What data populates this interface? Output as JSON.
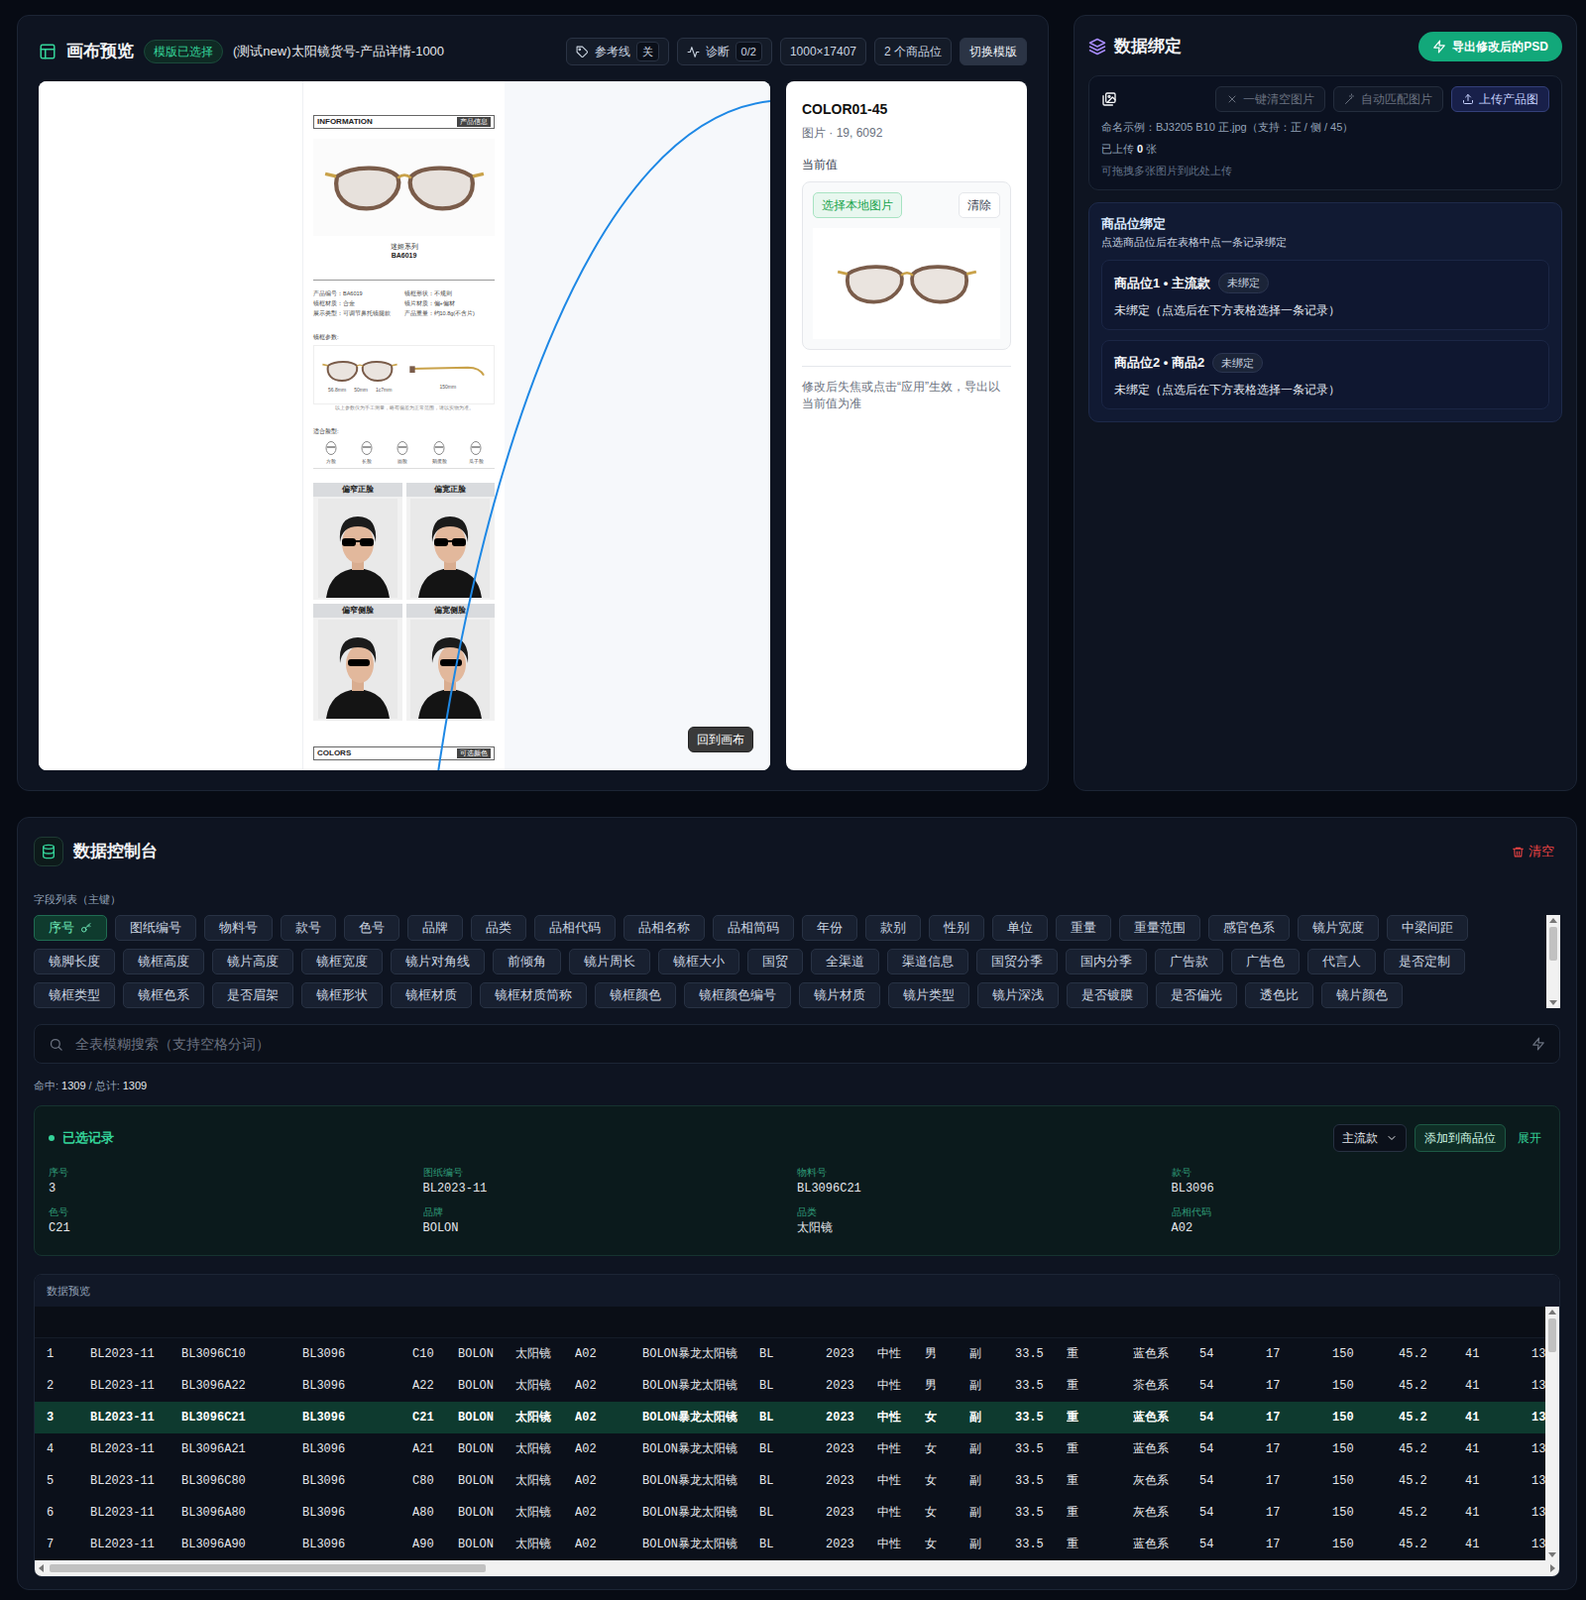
{
  "canvas_panel": {
    "title": "画布预览",
    "template_badge": "模版已选择",
    "template_name": "(测试new)太阳镜货号-产品详情-1000",
    "toolbar": [
      {
        "label": "参考线",
        "value": "关",
        "kind": "toggle"
      },
      {
        "label": "诊断",
        "value": "0/2",
        "kind": "diagnose"
      },
      {
        "label": "1000×17407",
        "kind": "info"
      },
      {
        "label": "2 个商品位",
        "kind": "info"
      },
      {
        "label": "切换模版",
        "kind": "action"
      }
    ],
    "back_button": "回到画布"
  },
  "document": {
    "header": [
      "INFORMATION",
      "产品信息"
    ],
    "series": "迷姬系列",
    "model": "BA6019",
    "specs": [
      [
        "产品编号：BA6019",
        "镜框形状：不规则"
      ],
      [
        "镜框材质：合金",
        "镜片材质：偏+偏材"
      ],
      [
        "展示类型：可调节鼻托镜腿款",
        "产品重量：约10.8g(不含片)"
      ]
    ],
    "params_label": "镜框参数:",
    "dims": [
      "56.8mm",
      "50mm",
      "1c7mm",
      "150mm"
    ],
    "note": "以上参数仅为手工测量，略有偏差为正常范围，请以实物为准。",
    "faces_label": "适合脸型:",
    "faces": [
      "方脸",
      "长脸",
      "圆脸",
      "鹅蛋脸",
      "瓜子脸"
    ],
    "photos": [
      "偏窄正脸",
      "偏宽正脸",
      "偏窄侧脸",
      "偏宽侧脸"
    ],
    "footer": [
      "COLORS",
      "可选颜色"
    ]
  },
  "layer_card": {
    "name": "COLOR01-45",
    "meta": "图片 · 19, 6092",
    "current_label": "当前值",
    "choose": "选择本地图片",
    "clear": "清除",
    "hint": "修改后失焦或点击“应用”生效，导出以当前值为准"
  },
  "binding_panel": {
    "title": "数据绑定",
    "export": "导出修改后的PSD",
    "upload": {
      "actions": [
        {
          "label": "一键清空图片",
          "kind": "ghost"
        },
        {
          "label": "自动匹配图片",
          "kind": "ghost"
        },
        {
          "label": "上传产品图",
          "kind": "primary"
        }
      ],
      "naming": "命名示例：BJ3205 B10 正.jpg（支持：正 / 侧 / 45）",
      "uploaded": {
        "prefix": "已上传",
        "count": "0",
        "suffix": "张"
      },
      "drop_hint": "可拖拽多张图片到此处上传"
    },
    "slots": {
      "title": "商品位绑定",
      "hint": "点选商品位后在表格中点一条记录绑定",
      "items": [
        {
          "name": "商品位1 • 主流款",
          "status": "未绑定",
          "detail": "未绑定（点选后在下方表格选择一条记录）"
        },
        {
          "name": "商品位2 • 商品2",
          "status": "未绑定",
          "detail": "未绑定（点选后在下方表格选择一条记录）"
        }
      ]
    }
  },
  "console": {
    "title": "数据控制台",
    "clear": "清空",
    "fields_label": "字段列表（主键）",
    "fields": [
      {
        "label": "序号",
        "selected": true,
        "primary_key": true
      },
      {
        "label": "图纸编号",
        "selected": false,
        "primary_key": false
      },
      {
        "label": "物料号",
        "selected": false,
        "primary_key": false
      },
      {
        "label": "款号",
        "selected": false,
        "primary_key": false
      },
      {
        "label": "色号",
        "selected": false,
        "primary_key": false
      },
      {
        "label": "品牌",
        "selected": false,
        "primary_key": false
      },
      {
        "label": "品类",
        "selected": false,
        "primary_key": false
      },
      {
        "label": "品相代码",
        "selected": false,
        "primary_key": false
      },
      {
        "label": "品相名称",
        "selected": false,
        "primary_key": false
      },
      {
        "label": "品相简码",
        "selected": false,
        "primary_key": false
      },
      {
        "label": "年份",
        "selected": false,
        "primary_key": false
      },
      {
        "label": "款别",
        "selected": false,
        "primary_key": false
      },
      {
        "label": "性别",
        "selected": false,
        "primary_key": false
      },
      {
        "label": "单位",
        "selected": false,
        "primary_key": false
      },
      {
        "label": "重量",
        "selected": false,
        "primary_key": false
      },
      {
        "label": "重量范围",
        "selected": false,
        "primary_key": false
      },
      {
        "label": "感官色系",
        "selected": false,
        "primary_key": false
      },
      {
        "label": "镜片宽度",
        "selected": false,
        "primary_key": false
      },
      {
        "label": "中梁间距",
        "selected": false,
        "primary_key": false
      },
      {
        "label": "镜脚长度",
        "selected": false,
        "primary_key": false
      },
      {
        "label": "镜框高度",
        "selected": false,
        "primary_key": false
      },
      {
        "label": "镜片高度",
        "selected": false,
        "primary_key": false
      },
      {
        "label": "镜框宽度",
        "selected": false,
        "primary_key": false
      },
      {
        "label": "镜片对角线",
        "selected": false,
        "primary_key": false
      },
      {
        "label": "前倾角",
        "selected": false,
        "primary_key": false
      },
      {
        "label": "镜片周长",
        "selected": false,
        "primary_key": false
      },
      {
        "label": "镜框大小",
        "selected": false,
        "primary_key": false
      },
      {
        "label": "国贸",
        "selected": false,
        "primary_key": false
      },
      {
        "label": "全渠道",
        "selected": false,
        "primary_key": false
      },
      {
        "label": "渠道信息",
        "selected": false,
        "primary_key": false
      },
      {
        "label": "国贸分季",
        "selected": false,
        "primary_key": false
      },
      {
        "label": "国内分季",
        "selected": false,
        "primary_key": false
      },
      {
        "label": "广告款",
        "selected": false,
        "primary_key": false
      },
      {
        "label": "广告色",
        "selected": false,
        "primary_key": false
      },
      {
        "label": "代言人",
        "selected": false,
        "primary_key": false
      },
      {
        "label": "是否定制",
        "selected": false,
        "primary_key": false
      },
      {
        "label": "镜框类型",
        "selected": false,
        "primary_key": false
      },
      {
        "label": "镜框色系",
        "selected": false,
        "primary_key": false
      },
      {
        "label": "是否眉架",
        "selected": false,
        "primary_key": false
      },
      {
        "label": "镜框形状",
        "selected": false,
        "primary_key": false
      },
      {
        "label": "镜框材质",
        "selected": false,
        "primary_key": false
      },
      {
        "label": "镜框材质简称",
        "selected": false,
        "primary_key": false
      },
      {
        "label": "镜框颜色",
        "selected": false,
        "primary_key": false
      },
      {
        "label": "镜框颜色编号",
        "selected": false,
        "primary_key": false
      },
      {
        "label": "镜片材质",
        "selected": false,
        "primary_key": false
      },
      {
        "label": "镜片类型",
        "selected": false,
        "primary_key": false
      },
      {
        "label": "镜片深浅",
        "selected": false,
        "primary_key": false
      },
      {
        "label": "是否镀膜",
        "selected": false,
        "primary_key": false
      },
      {
        "label": "是否偏光",
        "selected": false,
        "primary_key": false
      },
      {
        "label": "透色比",
        "selected": false,
        "primary_key": false
      },
      {
        "label": "镜片颜色",
        "selected": false,
        "primary_key": false
      }
    ],
    "search": {
      "placeholder": "全表模糊搜索（支持空格分词）"
    },
    "hits": {
      "hit_label": "命中:",
      "hit": "1309",
      "total_label": "/ 总计:",
      "total": "1309"
    },
    "selected_record": {
      "title": "已选记录",
      "slot_select": "主流款",
      "add": "添加到商品位",
      "expand": "展开",
      "fields": [
        {
          "label": "序号",
          "value": "3"
        },
        {
          "label": "图纸编号",
          "value": "BL2023-11"
        },
        {
          "label": "物料号",
          "value": "BL3096C21"
        },
        {
          "label": "款号",
          "value": "BL3096"
        },
        {
          "label": "色号",
          "value": "C21"
        },
        {
          "label": "品牌",
          "value": "BOLON"
        },
        {
          "label": "品类",
          "value": "太阳镜"
        },
        {
          "label": "品相代码",
          "value": "A02"
        }
      ]
    },
    "preview": {
      "title": "数据预览",
      "rows": [
        {
          "selected": false,
          "cells": [
            "1",
            "BL2023-11",
            "BL3096C10",
            "BL3096",
            "C10",
            "BOLON",
            "太阳镜",
            "A02",
            "BOLON暴龙太阳镜",
            "BL",
            "2023",
            "中性",
            "男",
            "副",
            "33.5",
            "重",
            "蓝色系",
            "54",
            "17",
            "150",
            "45.2",
            "41",
            "13"
          ]
        },
        {
          "selected": false,
          "cells": [
            "2",
            "BL2023-11",
            "BL3096A22",
            "BL3096",
            "A22",
            "BOLON",
            "太阳镜",
            "A02",
            "BOLON暴龙太阳镜",
            "BL",
            "2023",
            "中性",
            "男",
            "副",
            "33.5",
            "重",
            "茶色系",
            "54",
            "17",
            "150",
            "45.2",
            "41",
            "13"
          ]
        },
        {
          "selected": true,
          "cells": [
            "3",
            "BL2023-11",
            "BL3096C21",
            "BL3096",
            "C21",
            "BOLON",
            "太阳镜",
            "A02",
            "BOLON暴龙太阳镜",
            "BL",
            "2023",
            "中性",
            "女",
            "副",
            "33.5",
            "重",
            "蓝色系",
            "54",
            "17",
            "150",
            "45.2",
            "41",
            "13"
          ]
        },
        {
          "selected": false,
          "cells": [
            "4",
            "BL2023-11",
            "BL3096A21",
            "BL3096",
            "A21",
            "BOLON",
            "太阳镜",
            "A02",
            "BOLON暴龙太阳镜",
            "BL",
            "2023",
            "中性",
            "女",
            "副",
            "33.5",
            "重",
            "蓝色系",
            "54",
            "17",
            "150",
            "45.2",
            "41",
            "13"
          ]
        },
        {
          "selected": false,
          "cells": [
            "5",
            "BL2023-11",
            "BL3096C80",
            "BL3096",
            "C80",
            "BOLON",
            "太阳镜",
            "A02",
            "BOLON暴龙太阳镜",
            "BL",
            "2023",
            "中性",
            "女",
            "副",
            "33.5",
            "重",
            "灰色系",
            "54",
            "17",
            "150",
            "45.2",
            "41",
            "13"
          ]
        },
        {
          "selected": false,
          "cells": [
            "6",
            "BL2023-11",
            "BL3096A80",
            "BL3096",
            "A80",
            "BOLON",
            "太阳镜",
            "A02",
            "BOLON暴龙太阳镜",
            "BL",
            "2023",
            "中性",
            "女",
            "副",
            "33.5",
            "重",
            "灰色系",
            "54",
            "17",
            "150",
            "45.2",
            "41",
            "13"
          ]
        },
        {
          "selected": false,
          "cells": [
            "7",
            "BL2023-11",
            "BL3096A90",
            "BL3096",
            "A90",
            "BOLON",
            "太阳镜",
            "A02",
            "BOLON暴龙太阳镜",
            "BL",
            "2023",
            "中性",
            "女",
            "副",
            "33.5",
            "重",
            "蓝色系",
            "54",
            "17",
            "150",
            "45.2",
            "41",
            "13"
          ]
        }
      ]
    }
  }
}
